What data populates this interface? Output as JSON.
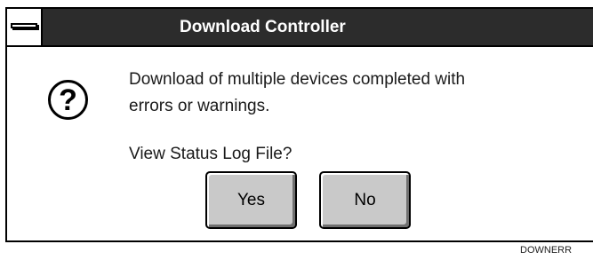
{
  "window": {
    "title": "Download Controller",
    "system_menu_icon": "system-menu-bar-icon"
  },
  "dialog": {
    "icon": "question-icon",
    "icon_glyph": "?",
    "message_line1": "Download of multiple devices completed with",
    "message_line2": "errors or warnings.",
    "question": "View Status Log File?"
  },
  "buttons": {
    "yes_label": "Yes",
    "no_label": "No"
  },
  "footer": {
    "figure_id": "DOWNERR"
  },
  "colors": {
    "titlebar": "#2c2c2c",
    "button_face": "#c9c9c9",
    "background": "#ffffff"
  }
}
